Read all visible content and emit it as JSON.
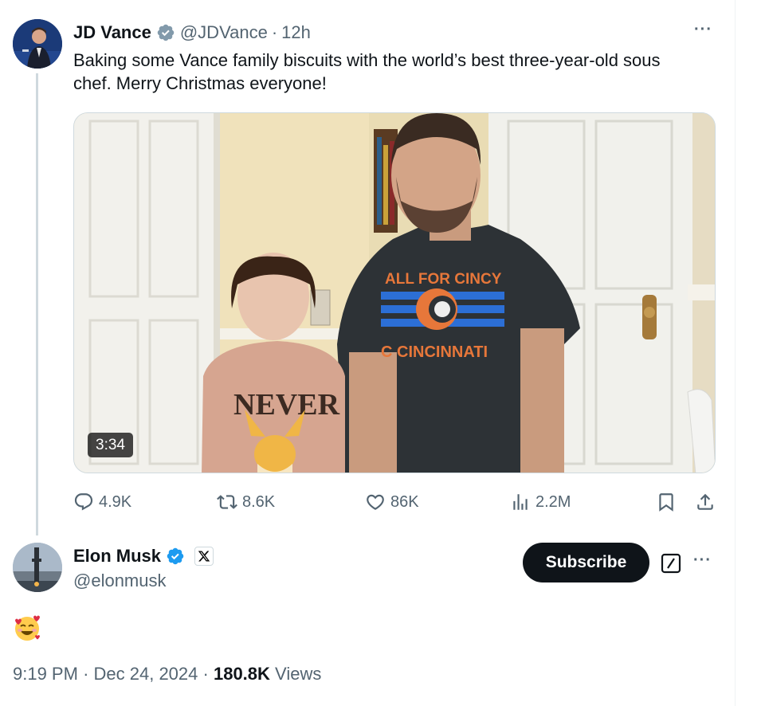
{
  "colors": {
    "accent": "#1d9bf0",
    "text_primary": "#0f1419",
    "text_secondary": "#536471",
    "subscribe_bg": "#0f1419"
  },
  "parent_tweet": {
    "name": "JD Vance",
    "handle": "@JDVance",
    "separator": "·",
    "time": "12h",
    "more": "···",
    "text": "Baking some Vance family biscuits with the world’s best three-year-old sous chef. Merry Christmas everyone!",
    "video": {
      "duration": "3:34",
      "shirt_text_top": "ALL FOR CINCY",
      "shirt_text_bottom": "C CINCINNATI",
      "sweater_text": "NEVER"
    },
    "actions": {
      "replies": "4.9K",
      "reposts": "8.6K",
      "likes": "86K",
      "views": "2.2M"
    }
  },
  "reply_tweet": {
    "name": "Elon Musk",
    "handle": "@elonmusk",
    "subscribe_label": "Subscribe",
    "more": "···",
    "emoji": "smiling-face-with-hearts",
    "meta": {
      "time": "9:19 PM",
      "separator": "·",
      "date": "Dec 24, 2024",
      "separator2": "·",
      "views_count": "180.8K",
      "views_label": "Views"
    }
  }
}
